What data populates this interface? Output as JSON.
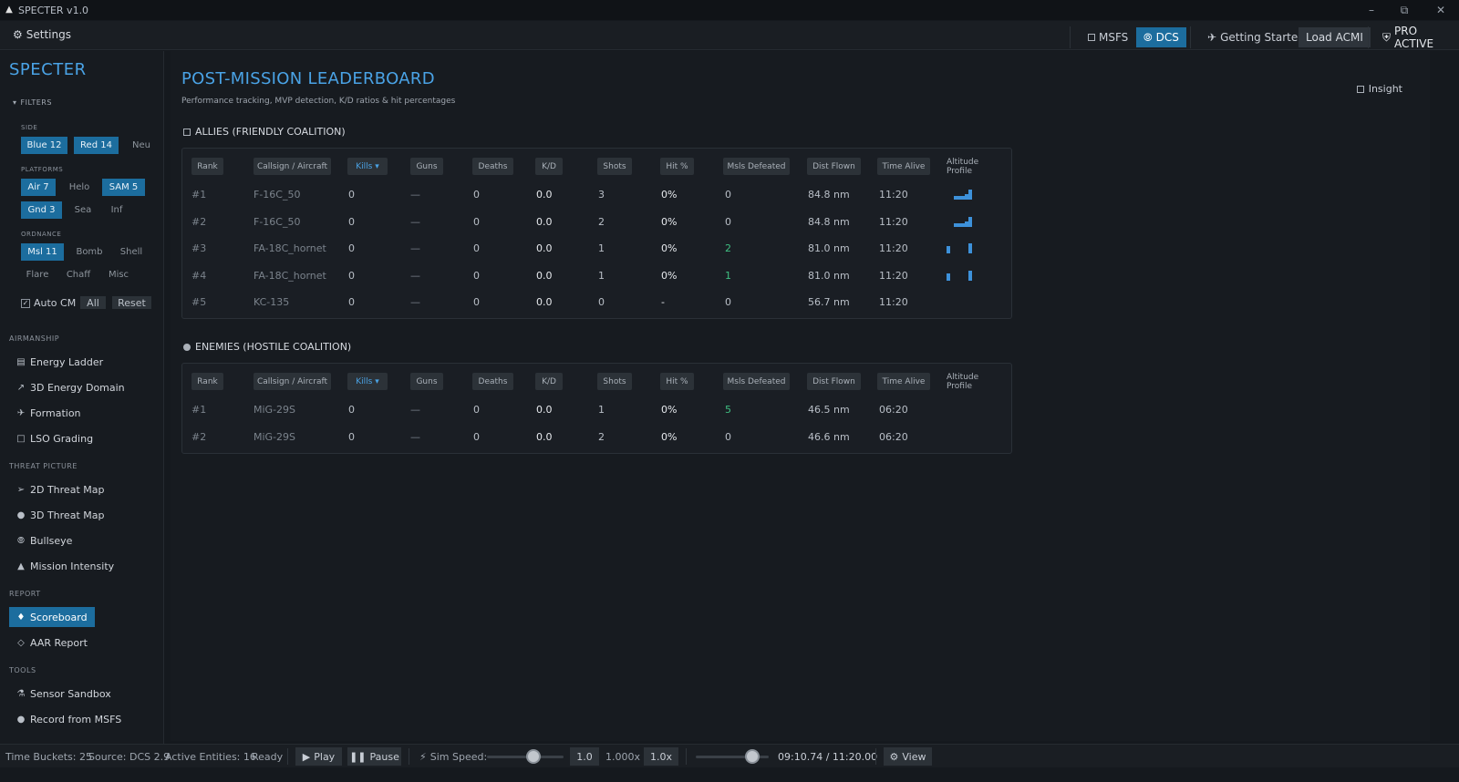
{
  "window": {
    "title": "SPECTER v1.0"
  },
  "topbar": {
    "settings_label": "Settings",
    "msfs_label": "MSFS",
    "dcs_label": "DCS",
    "getting_started_label": "Getting Started",
    "load_acmi_label": "Load ACMI",
    "pro_active_label": "PRO ACTIVE"
  },
  "sidebar": {
    "brand": "SPECTER",
    "filters_title": "FILTERS",
    "side_label": "SIDE",
    "side_chips": [
      "Blue 12",
      "Red 14",
      "Neu"
    ],
    "platforms_label": "PLATFORMS",
    "platform_chips": [
      "Air 7",
      "Helo",
      "SAM 5",
      "Gnd 3",
      "Sea",
      "Inf"
    ],
    "ordnance_label": "ORDNANCE",
    "ordnance_chips": [
      "Msl 11",
      "Bomb",
      "Shell",
      "Flare",
      "Chaff",
      "Misc"
    ],
    "auto_cm_label": "Auto CM",
    "all_label": "All",
    "reset_label": "Reset",
    "sections": {
      "airmanship": "AIRMANSHIP",
      "threat_picture": "THREAT PICTURE",
      "report": "REPORT",
      "tools": "TOOLS"
    },
    "nav": {
      "energy_ladder": "Energy Ladder",
      "energy_domain_3d": "3D Energy Domain",
      "formation": "Formation",
      "lso_grading": "LSO Grading",
      "threat_map_2d": "2D Threat Map",
      "threat_map_3d": "3D Threat Map",
      "bullseye": "Bullseye",
      "mission_intensity": "Mission Intensity",
      "scoreboard": "Scoreboard",
      "aar_report": "AAR Report",
      "sensor_sandbox": "Sensor Sandbox",
      "record_from_msfs": "Record from MSFS"
    }
  },
  "main": {
    "title": "POST-MISSION LEADERBOARD",
    "subtitle": "Performance tracking, MVP detection, K/D ratios & hit percentages",
    "insight_label": "Insight",
    "columns": [
      "Rank",
      "Callsign / Aircraft",
      "Kills ▾",
      "Guns",
      "Deaths",
      "K/D",
      "Shots",
      "Hit %",
      "Msls Defeated",
      "Dist Flown",
      "Time Alive",
      "Altitude Profile"
    ],
    "allies": {
      "heading": "ALLIES (FRIENDLY COALITION)",
      "rows": [
        {
          "rank": "#1",
          "callsign": "F-16C_50",
          "kills": "0",
          "guns": "—",
          "deaths": "0",
          "kd": "0.0",
          "shots": "3",
          "hit": "0%",
          "msls": "0",
          "dist": "84.8 nm",
          "time": "11:20"
        },
        {
          "rank": "#2",
          "callsign": "F-16C_50",
          "kills": "0",
          "guns": "—",
          "deaths": "0",
          "kd": "0.0",
          "shots": "2",
          "hit": "0%",
          "msls": "0",
          "dist": "84.8 nm",
          "time": "11:20"
        },
        {
          "rank": "#3",
          "callsign": "FA-18C_hornet",
          "kills": "0",
          "guns": "—",
          "deaths": "0",
          "kd": "0.0",
          "shots": "1",
          "hit": "0%",
          "msls": "2",
          "dist": "81.0 nm",
          "time": "11:20"
        },
        {
          "rank": "#4",
          "callsign": "FA-18C_hornet",
          "kills": "0",
          "guns": "—",
          "deaths": "0",
          "kd": "0.0",
          "shots": "1",
          "hit": "0%",
          "msls": "1",
          "dist": "81.0 nm",
          "time": "11:20"
        },
        {
          "rank": "#5",
          "callsign": "KC-135",
          "kills": "0",
          "guns": "—",
          "deaths": "0",
          "kd": "0.0",
          "shots": "0",
          "hit": "-",
          "msls": "0",
          "dist": "56.7 nm",
          "time": "11:20"
        }
      ]
    },
    "enemies": {
      "heading": "ENEMIES (HOSTILE COALITION)",
      "rows": [
        {
          "rank": "#1",
          "callsign": "MiG-29S",
          "kills": "0",
          "guns": "—",
          "deaths": "0",
          "kd": "0.0",
          "shots": "1",
          "hit": "0%",
          "msls": "5",
          "dist": "46.5 nm",
          "time": "06:20"
        },
        {
          "rank": "#2",
          "callsign": "MiG-29S",
          "kills": "0",
          "guns": "—",
          "deaths": "0",
          "kd": "0.0",
          "shots": "2",
          "hit": "0%",
          "msls": "0",
          "dist": "46.6 nm",
          "time": "06:20"
        }
      ]
    }
  },
  "statusbar": {
    "time_buckets": "Time Buckets: 25",
    "source": "Source: DCS 2.9",
    "active_entities": "Active Entities: 16",
    "status": "Ready",
    "play_label": "Play",
    "pause_label": "Pause",
    "sim_speed_label": "Sim Speed:",
    "speed_value": "1.0",
    "speed_multiplier": "1.000x",
    "speed_reset": "1.0x",
    "time_readout": "09:10.74 / 11:20.00",
    "view_label": "View"
  },
  "colors": {
    "accent": "#4aa3e6",
    "active_button": "#1c6d9e",
    "positive": "#3fbf82",
    "background": "#15191e"
  }
}
